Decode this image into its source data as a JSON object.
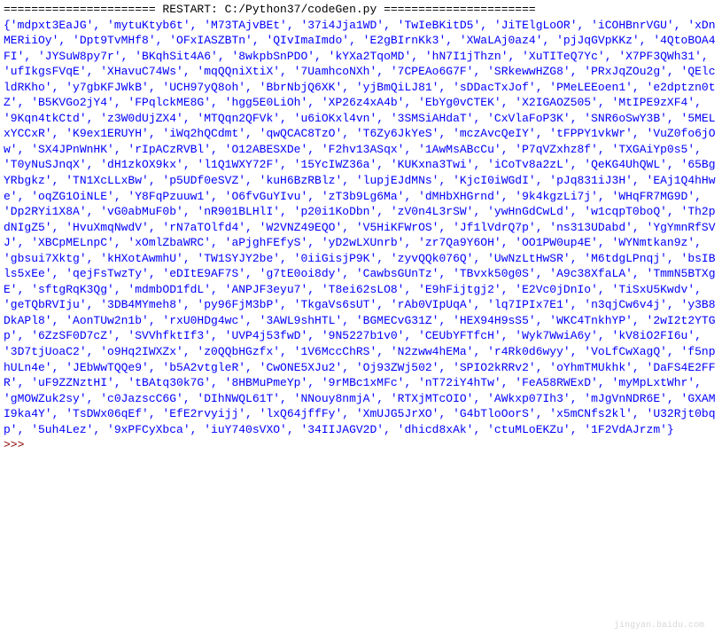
{
  "restart": {
    "prefix": "====================== RESTART: ",
    "path": "C:/Python37/codeGen.py",
    "suffix": " ======================"
  },
  "prompt": ">>> ",
  "set_items": [
    "mdpxt3EaJG",
    "mytuKtyb6t",
    "M73TAjvBEt",
    "37i4Jja1WD",
    "TwIeBKitD5",
    "JiTElgLoOR",
    "iCOHBnrVGU",
    "xDnMERiiOy",
    "Dpt9TvMHf8",
    "OFxIASZBTn",
    "QIvImaImdo",
    "E2gBIrnKk3",
    "XWaLAj0az4",
    "pjJqGVpKKz",
    "4QtoBOA4FI",
    "JYSuW8py7r",
    "BKqhSit4A6",
    "8wkpbSnPDO",
    "kYXa2TqoMD",
    "hN7I1jThzn",
    "XuTITeQ7Yc",
    "X7PF3QWh31",
    "ufIkgsFVqE",
    "XHavuC74Ws",
    "mqQQniXtiX",
    "7UamhcoNXh",
    "7CPEAo6G7F",
    "SRkewwHZG8",
    "PRxJqZOu2g",
    "QElcldRKho",
    "y7gbKFJWkB",
    "UCH97yQ8oh",
    "BbrNbjQ6XK",
    "yjBmQiLJ81",
    "sDDacTxJof",
    "PMeLEEoen1",
    "e2dptzn0tZ",
    "B5KVGo2jY4",
    "FPqlckME8G",
    "hgg5E0LiOh",
    "XP26z4xA4b",
    "EbYg0vCTEK",
    "X2IGAOZ505",
    "MtIPE9zXF4",
    "9Kqn4tkCtd",
    "z3W0dUjZX4",
    "MTQqn2QFVk",
    "u6iOKxl4vn",
    "3SMSiAHdaT",
    "CxVlaFoP3K",
    "SNR6oSwY3B",
    "5MELxYCCxR",
    "K9ex1ERUYH",
    "iWq2hQCdmt",
    "qwQCAC8TzO",
    "T6Zy6JkYeS",
    "mczAvcQeIY",
    "tFPPY1vkWr",
    "VuZ0fo6jOw",
    "SX4JPnWnHK",
    "rIpACzRVBl",
    "O12ABESXDe",
    "F2hv13ASqx",
    "1AwMsABcCu",
    "P7qVZxhz8f",
    "TXGAiYp0s5",
    "T0yNuSJnqX",
    "dH1zkOX9kx",
    "l1Q1WXY72F",
    "15YcIWZ36a",
    "KUKxna3Twi",
    "iCoTv8a2zL",
    "QeKG4UhQWL",
    "65BgYRbgkz",
    "TN1XcLLxBw",
    "p5UDf0eSVZ",
    "kuH6BzRBlz",
    "lupjEJdMNs",
    "KjcI0iWGdI",
    "pJq831iJ3H",
    "EAj1Q4hHwe",
    "oqZG1OiNLE",
    "Y8FqPzuuw1",
    "O6fvGuYIvu",
    "zT3b9Lg6Ma",
    "dMHbXHGrnd",
    "9k4kgzLi7j",
    "WHqFR7MG9D",
    "Dp2RYi1X8A",
    "vG0abMuF0b",
    "nR901BLHlI",
    "p20i1KoDbn",
    "zV0n4L3rSW",
    "ywHnGdCwLd",
    "w1cqpT0boQ",
    "Th2pdNIgZ5",
    "HvuXmqNwdV",
    "rN7aTOlfd4",
    "W2VNZ49EQO",
    "V5HiKFWrOS",
    "Jf1lVdrQ7p",
    "ns313UDabd",
    "YgYmnRfSVJ",
    "XBCpMELnpC",
    "xOmlZbaWRC",
    "aPjghFEfyS",
    "yD2wLXUnrb",
    "zr7Qa9Y6OH",
    "OO1PW0up4E",
    "WYNmtkan9z",
    "gbsui7Xktg",
    "kHXotAwmhU",
    "TW1SYJY2be",
    "0iiGisjP9K",
    "zyvQQk076Q",
    "UwNzLtHwSR",
    "M6tdgLPnqj",
    "bsIBls5xEe",
    "qejFsTwzTy",
    "eDItE9AF7S",
    "g7tE0oi8dy",
    "CawbsGUnTz",
    "TBvxk50g0S",
    "A9c38XfaLA",
    "TmmN5BTXgE",
    "sftgRqK3Qg",
    "mdmbOD1fdL",
    "ANPJF3eyu7",
    "T8ei62sLO8",
    "E9hFijtgj2",
    "E2Vc0jDnIo",
    "TiSxU5Kwdv",
    "geTQbRVIju",
    "3DB4MYmeh8",
    "py96FjM3bP",
    "TkgaVs6sUT",
    "rAb0VIpUqA",
    "lq7IPIx7E1",
    "n3qjCw6v4j",
    "y3B8DkAPl8",
    "AonTUw2n1b",
    "rxU0HDg4wc",
    "3AWL9shHTL",
    "BGMECvG31Z",
    "HEX94H9sS5",
    "WKC4TnkhYP",
    "2wI2t2YTGp",
    "6ZzSF0D7cZ",
    "SVVhfktIf3",
    "UVP4j53fwD",
    "9N5227b1v0",
    "CEUbYFTfcH",
    "Wyk7WwiA6y",
    "kV8iO2FI6u",
    "3D7tjUoaC2",
    "o9Hq2IWXZx",
    "z0QQbHGzfx",
    "1V6MccChRS",
    "N2zww4hEMa",
    "r4Rk0d6wyy",
    "VoLfCwXagQ",
    "f5nphULn4e",
    "JEbWwTQQe9",
    "b5A2vtgleR",
    "CwONE5XJu2",
    "Oj93ZWj502",
    "SPIO2kRRv2",
    "oYhmTMUkhk",
    "DaFS4E2FFR",
    "uF9ZZNztHI",
    "tBAtq30k7G",
    "8HBMuPmeYp",
    "9rMBc1xMFc",
    "nT72iY4hTw",
    "FeA58RWExD",
    "myMpLxtWhr",
    "gMOWZuk2sy",
    "c0JazscC6G",
    "DIhNWQL61T",
    "NNouy8nmjA",
    "RTXjMTcOIO",
    "AWkxp07Ih3",
    "mJgVnNDR6E",
    "GXAMI9ka4Y",
    "TsDWx06qEf",
    "EfE2rvyijj",
    "lxQ64jffFy",
    "XmUJG5JrXO",
    "G4bTloOorS",
    "x5mCNfs2kl",
    "U32Rjt0bqp",
    "5uh4Lez",
    "9xPFCyXbca",
    "iuY740sVXO",
    "34IIJAGV2D",
    "dhicd8xAk",
    "ctuMLoEKZu",
    "1F2VdAJrzm"
  ],
  "watermark": {
    "line1": "",
    "line2": "jingyan.baidu.com"
  }
}
